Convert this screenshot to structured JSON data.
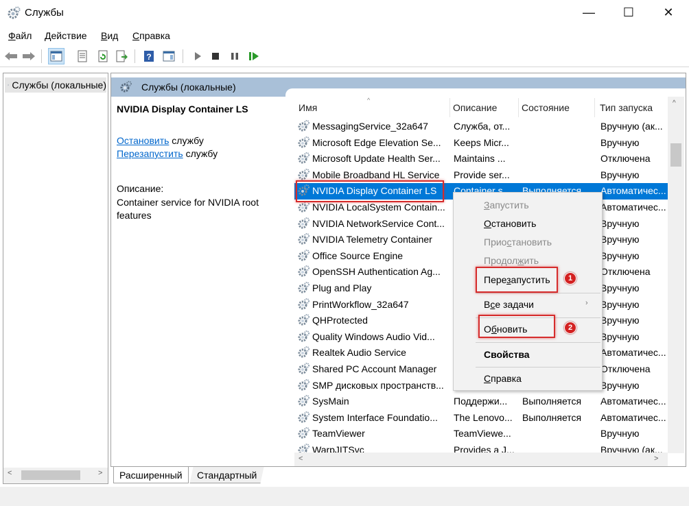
{
  "window": {
    "title": "Службы",
    "controls": {
      "minimize": "—",
      "maximize": "☐",
      "close": "✕"
    }
  },
  "menu": [
    {
      "label": "Файл",
      "accel": "Ф",
      "rest": "айл"
    },
    {
      "label": "Действие",
      "accel": "Д",
      "rest": "ействие"
    },
    {
      "label": "Вид",
      "accel": "В",
      "rest": "ид"
    },
    {
      "label": "Справка",
      "accel": "С",
      "rest": "правка"
    }
  ],
  "toolbar": {
    "icons": [
      "back-arrow-icon",
      "forward-arrow-icon",
      "show-console-tree-icon",
      "properties-sheet-icon",
      "refresh-icon",
      "export-list-icon",
      "help-icon",
      "action-pane-icon",
      "start-service-icon",
      "stop-service-icon",
      "pause-service-icon",
      "restart-service-icon"
    ]
  },
  "tree": {
    "selected_item": "Службы (локальные)"
  },
  "right_pane": {
    "header": "Службы (локальные)",
    "selected_service_title": "NVIDIA Display Container LS",
    "actions": [
      {
        "link": "Остановить",
        "suffix": " службу"
      },
      {
        "link": "Перезапустить",
        "suffix": " службу"
      }
    ],
    "description_label": "Описание:",
    "description_text": "Container service for NVIDIA root features",
    "columns": [
      "Имя",
      "Описание",
      "Состояние",
      "Тип запуска"
    ],
    "rows": [
      {
        "name": "MessagingService_32a647",
        "desc": "Служба, от...",
        "state": "",
        "start": "Вручную (ак..."
      },
      {
        "name": "Microsoft Edge Elevation Se...",
        "desc": "Keeps Micr...",
        "state": "",
        "start": "Вручную"
      },
      {
        "name": "Microsoft Update Health Ser...",
        "desc": "Maintains ...",
        "state": "",
        "start": "Отключена"
      },
      {
        "name": "Mobile Broadband HL Service",
        "desc": "Provide ser...",
        "state": "",
        "start": "Вручную"
      },
      {
        "name": "NVIDIA Display Container LS",
        "desc": "Container s...",
        "state": "Выполняется",
        "start": "Автоматичес..."
      },
      {
        "name": "NVIDIA LocalSystem Contain...",
        "desc": "",
        "state": "",
        "start": "Автоматичес..."
      },
      {
        "name": "NVIDIA NetworkService Cont...",
        "desc": "",
        "state": "",
        "start": "Вручную"
      },
      {
        "name": "NVIDIA Telemetry Container",
        "desc": "",
        "state": "",
        "start": "Вручную"
      },
      {
        "name": "Office  Source Engine",
        "desc": "",
        "state": "",
        "start": "Вручную"
      },
      {
        "name": "OpenSSH Authentication Ag...",
        "desc": "",
        "state": "",
        "start": "Отключена"
      },
      {
        "name": "Plug and Play",
        "desc": "",
        "state": "",
        "start": "Вручную"
      },
      {
        "name": "PrintWorkflow_32a647",
        "desc": "",
        "state": "",
        "start": "Вручную"
      },
      {
        "name": "QHProtected",
        "desc": "",
        "state": "",
        "start": "Вручную"
      },
      {
        "name": "Quality Windows Audio Vid...",
        "desc": "",
        "state": "",
        "start": "Вручную"
      },
      {
        "name": "Realtek Audio Service",
        "desc": "",
        "state": "",
        "start": "Автоматичес..."
      },
      {
        "name": "Shared PC Account Manager",
        "desc": "",
        "state": "",
        "start": "Отключена"
      },
      {
        "name": "SMP дисковых пространств...",
        "desc": "Служба для ...",
        "state": "",
        "start": "Вручную"
      },
      {
        "name": "SysMain",
        "desc": "Поддержи...",
        "state": "Выполняется",
        "start": "Автоматичес..."
      },
      {
        "name": "System Interface Foundatio...",
        "desc": "The Lenovo...",
        "state": "Выполняется",
        "start": "Автоматичес..."
      },
      {
        "name": "TeamViewer",
        "desc": "TeamViewe...",
        "state": "",
        "start": "Вручную"
      },
      {
        "name": "WarpJITSvc",
        "desc": "Provides a J...",
        "state": "",
        "start": "Вручную (ак..."
      }
    ],
    "selected_row_index": 4
  },
  "context_menu": {
    "items": [
      {
        "label": "Запустить",
        "accel": "З",
        "state": "disabled"
      },
      {
        "label": "Остановить",
        "accel": "О",
        "state": "enabled"
      },
      {
        "label": "Приостановить",
        "accel": "с",
        "state": "disabled"
      },
      {
        "label": "Продолжить",
        "accel": "ж",
        "state": "disabled"
      },
      {
        "label": "Перезапустить",
        "accel": "з",
        "state": "enabled"
      },
      {
        "label": "Все задачи",
        "accel": "с",
        "state": "submenu"
      },
      {
        "label": "Обновить",
        "accel": "б",
        "state": "enabled"
      },
      {
        "label": "Свойства",
        "accel": "",
        "state": "bold"
      },
      {
        "label": "Справка",
        "accel": "С",
        "state": "enabled"
      }
    ],
    "submenu_arrow": "›"
  },
  "annotations": {
    "badge_1": "1",
    "badge_2": "2",
    "highlight_color": "#d62c2c"
  },
  "tabs": [
    {
      "label": "Расширенный",
      "active": true
    },
    {
      "label": "Стандартный",
      "active": false
    }
  ],
  "colors": {
    "selection": "#0078d7",
    "header_band": "#a9c0d8",
    "link": "#0066cc"
  }
}
